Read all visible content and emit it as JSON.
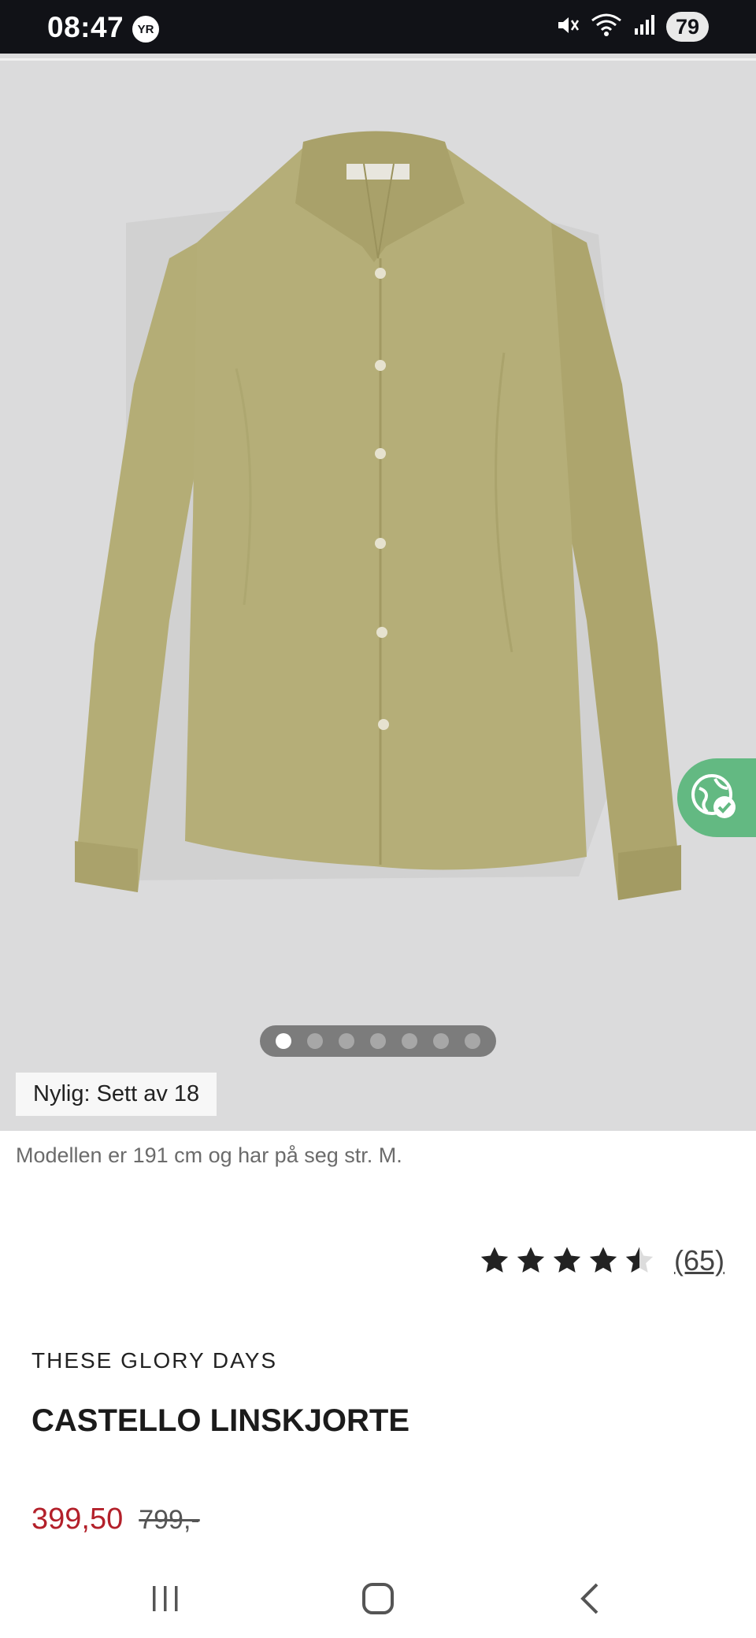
{
  "status_bar": {
    "time": "08:47",
    "yr_badge": "YR",
    "battery": "79",
    "icons": [
      "mute-icon",
      "wifi-icon",
      "signal-icon"
    ]
  },
  "product": {
    "recent_tag": "Nylig: Sett av 18",
    "model_info": "Modellen er 191 cm og har på seg str. M.",
    "rating_value": 4.5,
    "rating_count": "(65)",
    "brand": "THESE GLORY DAYS",
    "title": "CASTELLO LINSKJORTE",
    "price_sale": "399,50",
    "price_original": "799,-"
  },
  "carousel": {
    "total": 7,
    "active_index": 0
  },
  "nav": {
    "items": [
      "recents",
      "home",
      "back"
    ]
  },
  "colors": {
    "accent_sale": "#b3202a",
    "eco_green": "#63b982",
    "shirt": "#b5ae78"
  }
}
